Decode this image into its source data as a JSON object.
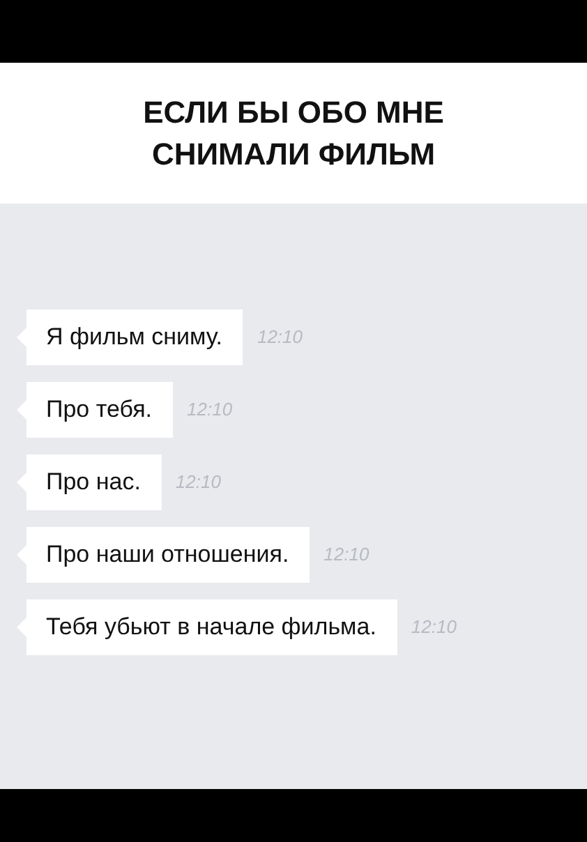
{
  "title": "ЕСЛИ БЫ ОБО МНЕ СНИМАЛИ ФИЛЬМ",
  "messages": [
    {
      "text": "Я фильм сниму.",
      "time": "12:10"
    },
    {
      "text": "Про тебя.",
      "time": "12:10"
    },
    {
      "text": "Про нас.",
      "time": "12:10"
    },
    {
      "text": "Про наши отношения.",
      "time": "12:10"
    },
    {
      "text": "Тебя убьют в начале фильма.",
      "time": "12:10"
    }
  ]
}
